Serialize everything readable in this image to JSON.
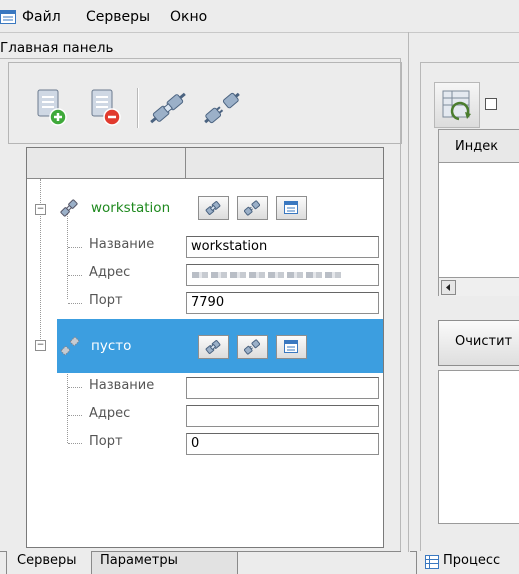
{
  "menu": {
    "items": [
      "Файл",
      "Серверы",
      "Окно"
    ]
  },
  "left_panel": {
    "title": "Главная панель",
    "toolbar": {
      "buttons": [
        "add-server-icon",
        "remove-server-icon",
        "connect-icon",
        "disconnect-icon"
      ]
    },
    "tree": {
      "nodes": [
        {
          "name": "workstation",
          "color": "#1f8a1f",
          "props": {
            "name_label": "Название",
            "name_value": "workstation",
            "address_label": "Адрес",
            "address_value": "",
            "port_label": "Порт",
            "port_value": "7790"
          }
        },
        {
          "name": "пусто",
          "props": {
            "name_label": "Название",
            "name_value": "",
            "address_label": "Адрес",
            "address_value": "",
            "port_label": "Порт",
            "port_value": "0"
          }
        }
      ]
    },
    "tabs": [
      "Серверы",
      "Параметры"
    ]
  },
  "right_panel": {
    "column_header": "Индек",
    "clear_button": "Очистит",
    "bottom_tab": "Процесс"
  },
  "colors": {
    "selection": "#3c9ee0",
    "connected_text": "#1f8a1f"
  }
}
